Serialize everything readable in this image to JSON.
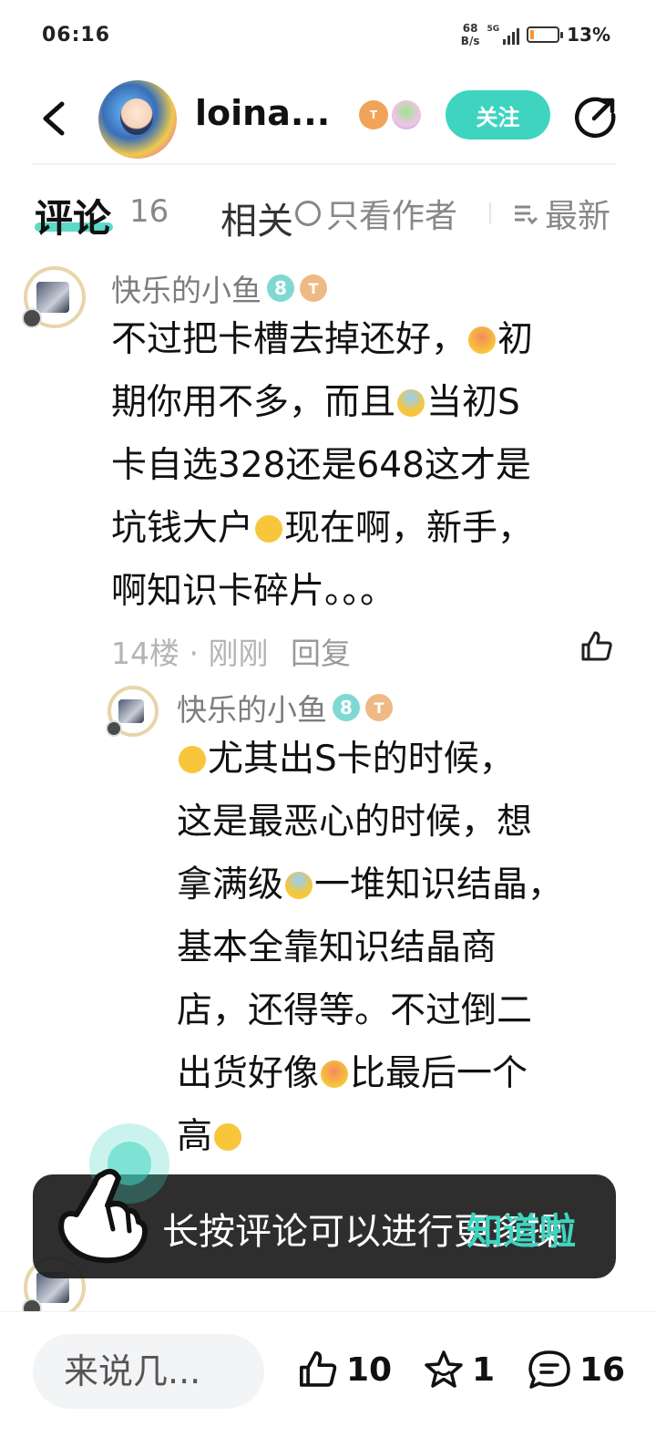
{
  "status": {
    "time": "06:16",
    "net_speed_value": "68",
    "net_speed_unit": "B/s",
    "signal_label": "5G",
    "battery_percent": "13%",
    "battery_level": 0.13,
    "battery_color": "#f29b21"
  },
  "header": {
    "author_name": "loina...",
    "badge_t": "T",
    "follow_label": "关注"
  },
  "tabs": {
    "comments_label": "评论",
    "comments_count": "16",
    "related_label": "相关",
    "author_only_label": "只看作者",
    "sort_label": "最新"
  },
  "comment1": {
    "nickname": "快乐的小鱼",
    "level": "8",
    "badge_t": "T",
    "lines": [
      "不过把卡槽去掉还好，",
      "初",
      "期你用不多，而且",
      "当初S",
      "卡自选328还是648这才是",
      "坑钱大户",
      "现在啊，新手，",
      "啊知识卡碎片。。。"
    ],
    "floor": "14楼",
    "dot": "·",
    "time": "刚刚",
    "reply_label": "回复"
  },
  "reply1": {
    "nickname": "快乐的小鱼",
    "level": "8",
    "badge_t": "T",
    "lines": [
      "尤其出S卡的时候，",
      "这是最恶心的时候，想",
      "拿满级",
      "一堆知识结晶，",
      "基本全靠知识结晶商",
      "店，还得等。不过倒二",
      "出货好像",
      "比最后一个",
      "高"
    ]
  },
  "toast": {
    "message": "长按评论可以进行更多操",
    "action": "知道啦"
  },
  "bottom": {
    "compose_placeholder": "来说几...",
    "like_count": "10",
    "favorite_count": "1",
    "comment_count": "16"
  },
  "colors": {
    "accent": "#3fd4c0",
    "text_primary": "#111111",
    "text_muted": "#7d7d7d"
  }
}
